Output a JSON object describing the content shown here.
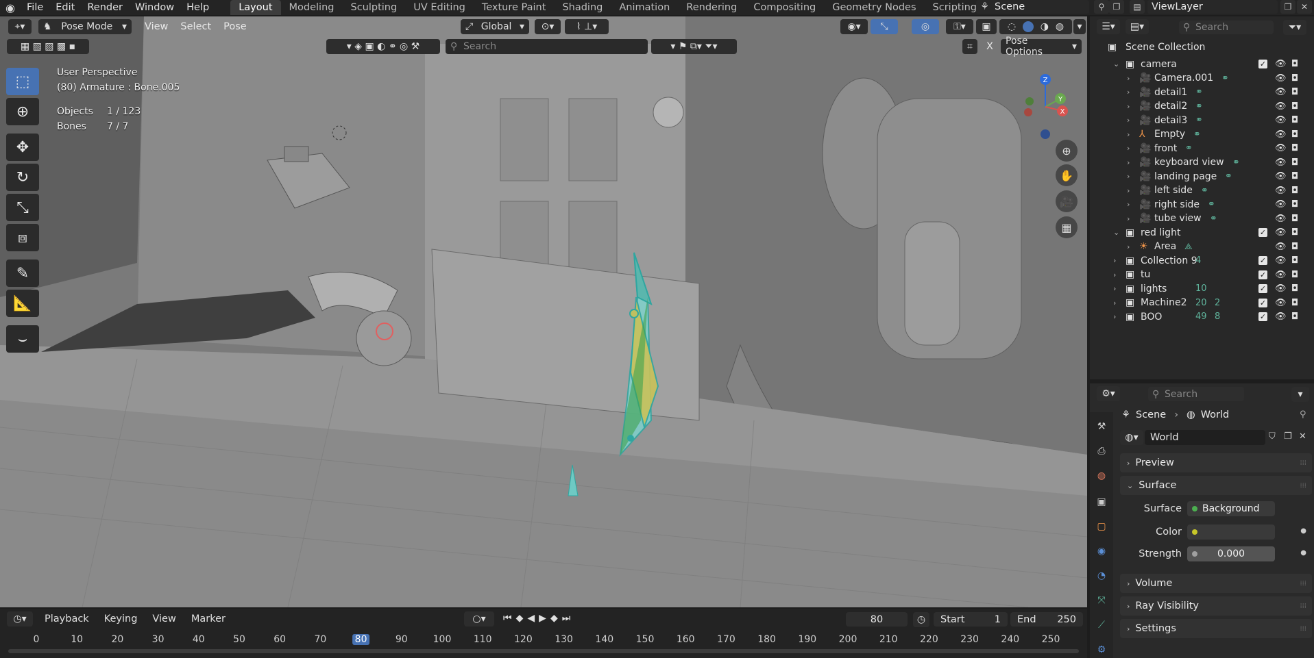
{
  "topbar": {
    "menus": [
      "File",
      "Edit",
      "Render",
      "Window",
      "Help"
    ],
    "workspaces": [
      "Layout",
      "Modeling",
      "Sculpting",
      "UV Editing",
      "Texture Paint",
      "Shading",
      "Animation",
      "Rendering",
      "Compositing",
      "Geometry Nodes",
      "Scripting"
    ],
    "active_workspace": "Layout",
    "scene": "Scene",
    "view_layer": "ViewLayer"
  },
  "viewport": {
    "mode": "Pose Mode",
    "menus": [
      "View",
      "Select",
      "Pose"
    ],
    "transform_orientation": "Global",
    "search_placeholder": "Search",
    "pose_options": "Pose Options",
    "x_mirror": "X",
    "overlay_title": "User Perspective",
    "overlay_subtitle": "(80) Armature : Bone.005",
    "stats": [
      {
        "label": "Objects",
        "value": "1 / 123"
      },
      {
        "label": "Bones",
        "value": "7 / 7"
      }
    ],
    "gizmo_axes": [
      "Z",
      "Y",
      "X"
    ]
  },
  "timeline": {
    "menus": [
      "Playback",
      "Keying",
      "View",
      "Marker"
    ],
    "current_frame": "80",
    "start_label": "Start",
    "start": "1",
    "end_label": "End",
    "end": "250",
    "ticks": [
      "0",
      "10",
      "20",
      "30",
      "40",
      "50",
      "60",
      "70",
      "80",
      "90",
      "100",
      "110",
      "120",
      "130",
      "140",
      "150",
      "160",
      "170",
      "180",
      "190",
      "200",
      "210",
      "220",
      "230",
      "240",
      "250"
    ]
  },
  "outliner": {
    "search_placeholder": "Search",
    "root": "Scene Collection",
    "rows": [
      {
        "label": "camera",
        "type": "collection",
        "level": 1,
        "expanded": true
      },
      {
        "label": "Camera.001",
        "type": "camera",
        "level": 2
      },
      {
        "label": "detail1",
        "type": "camera",
        "level": 2
      },
      {
        "label": "detail2",
        "type": "camera",
        "level": 2
      },
      {
        "label": "detail3",
        "type": "camera",
        "level": 2
      },
      {
        "label": "Empty",
        "type": "empty",
        "level": 2
      },
      {
        "label": "front",
        "type": "camera",
        "level": 2
      },
      {
        "label": "keyboard view",
        "type": "camera",
        "level": 2
      },
      {
        "label": "landing page",
        "type": "camera",
        "level": 2
      },
      {
        "label": "left side",
        "type": "camera",
        "level": 2
      },
      {
        "label": "right side",
        "type": "camera",
        "level": 2
      },
      {
        "label": "tube view",
        "type": "camera",
        "level": 2
      },
      {
        "label": "red light",
        "type": "collection",
        "level": 1,
        "expanded": true
      },
      {
        "label": "Area",
        "type": "light",
        "level": 2
      },
      {
        "label": "Collection 9",
        "type": "collection",
        "level": 1,
        "badge": "4"
      },
      {
        "label": "tu",
        "type": "collection",
        "level": 1
      },
      {
        "label": "lights",
        "type": "collection",
        "level": 1,
        "badge": "10"
      },
      {
        "label": "Machine2",
        "type": "collection",
        "level": 1,
        "badge": "20",
        "badge2": "2"
      },
      {
        "label": "BOO",
        "type": "collection",
        "level": 1,
        "badge": "49",
        "badge2": "8"
      }
    ]
  },
  "properties": {
    "search_placeholder": "Search",
    "breadcrumb": [
      "Scene",
      "World"
    ],
    "world_name": "World",
    "panels": {
      "preview": "Preview",
      "surface": "Surface",
      "volume": "Volume",
      "ray_visibility": "Ray Visibility",
      "settings": "Settings"
    },
    "surface_label": "Surface",
    "surface_value": "Background",
    "color_label": "Color",
    "strength_label": "Strength",
    "strength_value": "0.000"
  },
  "colors": {
    "accent": "#4772b3",
    "object_orange": "#f0954a",
    "data_teal": "#5fb49c"
  }
}
